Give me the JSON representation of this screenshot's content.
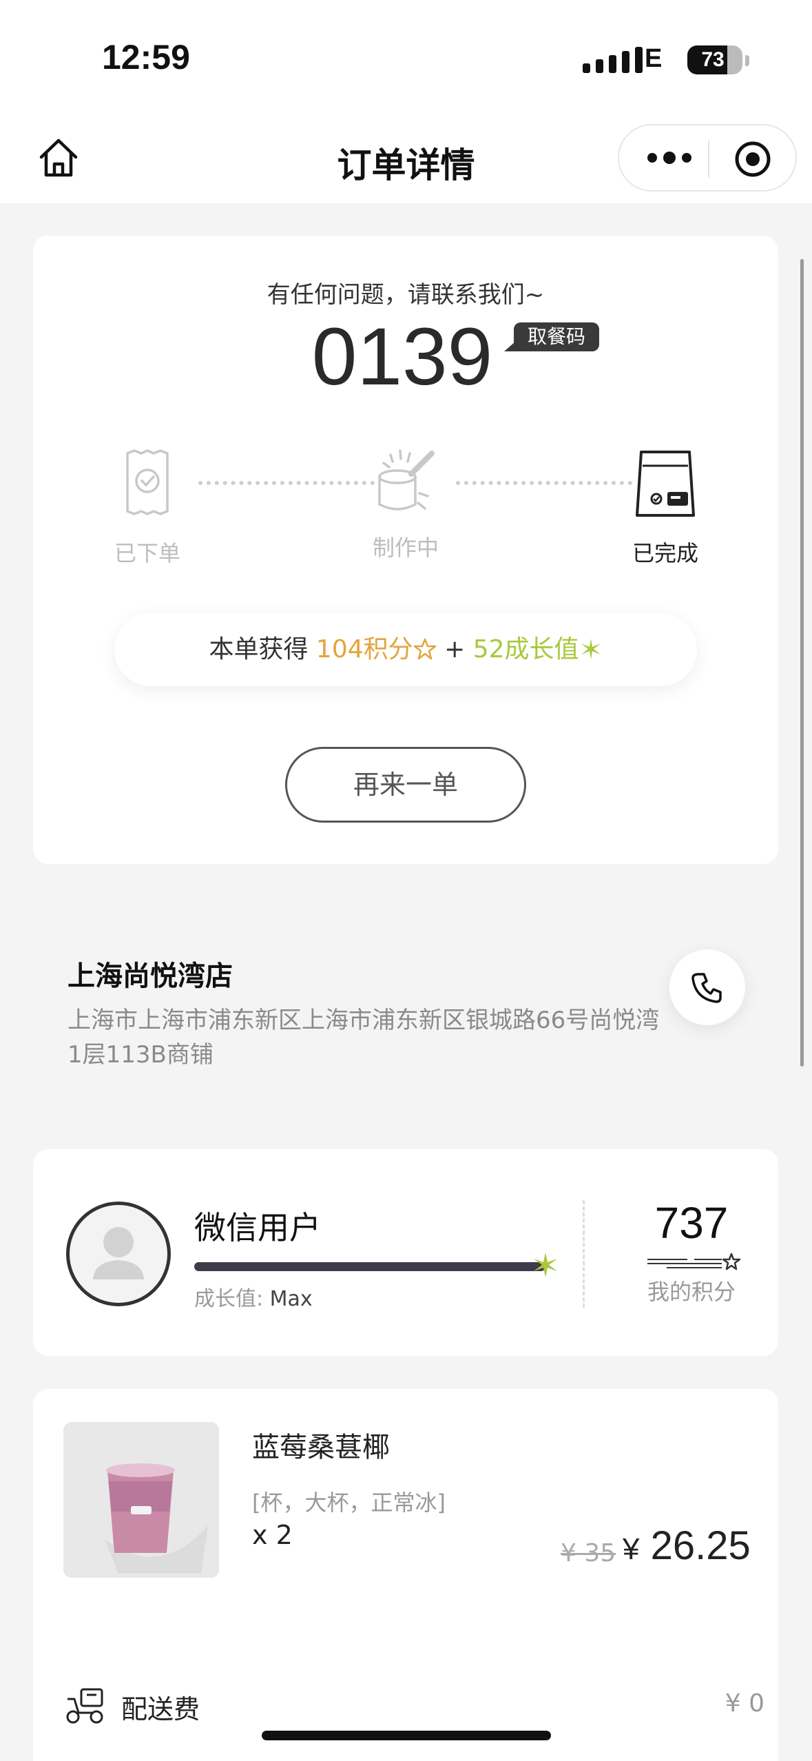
{
  "status_bar": {
    "time": "12:59",
    "network": "E",
    "battery": "73",
    "battery_level": 0.73
  },
  "nav": {
    "title": "订单详情"
  },
  "order": {
    "hint": "有任何问题，请联系我们~",
    "pickup_code": "0139",
    "pickup_tag": "取餐码",
    "steps": [
      {
        "label": "已下单",
        "state": "done"
      },
      {
        "label": "制作中",
        "state": "done"
      },
      {
        "label": "已完成",
        "state": "current"
      }
    ],
    "reward": {
      "prefix": "本单获得 ",
      "points": "104积分",
      "plus": " + ",
      "growth": "52成长值"
    },
    "again_button": "再来一单"
  },
  "store": {
    "name": "上海尚悦湾店",
    "address": "上海市上海市浦东新区上海市浦东新区银城路66号尚悦湾1层113B商铺"
  },
  "user": {
    "name": "微信用户",
    "growth_label": "成长值:",
    "growth_value": "Max",
    "growth_progress": 1.0,
    "points": "737",
    "points_label": "我的积分"
  },
  "product": {
    "name": "蓝莓桑葚椰",
    "spec": "[杯，大杯，正常冰]",
    "qty": "x 2",
    "original_price": "¥ 35",
    "currency": "¥",
    "price": "26.25"
  },
  "delivery": {
    "label": "配送费",
    "value": "¥ 0"
  },
  "colors": {
    "points": "#e3a43b",
    "growth": "#a9c83b",
    "text_muted": "#8a8a8a"
  }
}
